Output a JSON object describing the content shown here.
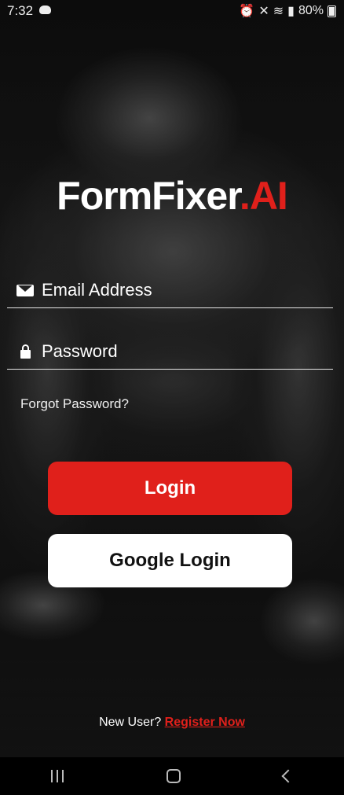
{
  "status_bar": {
    "time": "7:32",
    "battery": "80%",
    "icons": [
      "discord-icon",
      "alarm-icon",
      "mute-icon",
      "wifi-icon",
      "signal-icon",
      "battery-icon"
    ]
  },
  "logo": {
    "main": "FormFixer",
    "accent": ".AI",
    "accent_color": "#e0201b"
  },
  "email_field": {
    "placeholder": "Email Address",
    "icon": "envelope-icon"
  },
  "password_field": {
    "placeholder": "Password",
    "icon": "lock-icon"
  },
  "forgot_password": "Forgot Password?",
  "login_button": {
    "label": "Login",
    "color": "#e0201b"
  },
  "google_button": {
    "label": "Google Login",
    "color": "#ffffff"
  },
  "register": {
    "prompt": "New User?",
    "link": "Register Now"
  },
  "nav_bar": {
    "icons": [
      "recents-icon",
      "home-icon",
      "back-icon"
    ]
  }
}
